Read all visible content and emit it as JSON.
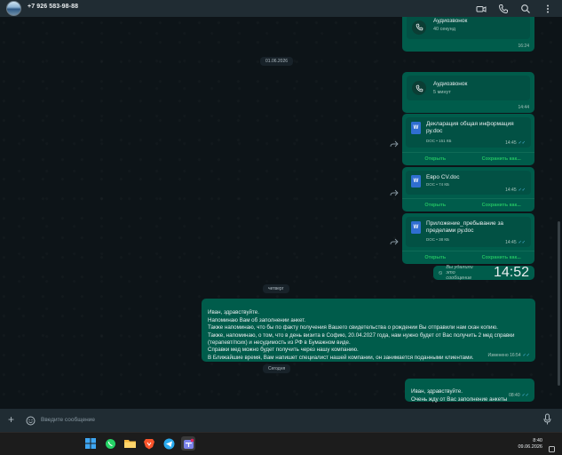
{
  "header": {
    "contact": "+7 926 583-98-88",
    "icons": [
      "video-call-icon",
      "voice-call-icon",
      "search-icon",
      "menu-dots-icon"
    ]
  },
  "messages": {
    "call1": {
      "title": "Аудиозвонок",
      "subtitle": "40 секунд",
      "time": "16:24"
    },
    "date1": "01.06.2026",
    "call2": {
      "title": "Аудиозвонок",
      "subtitle": "5 минут",
      "time": "14:44"
    },
    "doc1": {
      "name": "Декларация общая информация ру.doc",
      "meta": "DOC • 151 КБ",
      "time": "14:45",
      "open": "Открыть",
      "save": "Сохранить как..."
    },
    "doc2": {
      "name": "Евро CV.doc",
      "meta": "DOC • 74 КБ",
      "time": "14:45",
      "open": "Открыть",
      "save": "Сохранить как..."
    },
    "doc3": {
      "name": "Приложение_пребывание за пределами ру.doc",
      "meta": "DOC • 38 КБ",
      "time": "14:45",
      "open": "Открыть",
      "save": "Сохранить как..."
    },
    "deleted": {
      "text": "Вы удалили это сообщение",
      "time": "14:52"
    },
    "date2": "четверг",
    "long": {
      "text": "Иван, здравствуйте.\nНапоминаю Вам об заполнении анкет.\nТакже напоминаю, что бы по факту получения Вашего свидетельства о рождении Вы отправили нам скан копию.\nТакже, напоминаю, о том, что в день визита в Софию, 20.04.2027 года, нам нужно будет от Вас получить 2 мед справки\n(терапевт/псих) и несудимость из РФ в Бумажном виде.\nСправки мед можно будет получить через нашу компанию.\nВ Ближайшие время, Вам напишет специалист нашей компании, он занимается поданными клиентами.",
      "time": "Изменено 16:54"
    },
    "date3": "Сегодня",
    "last": {
      "text": "Иван, здравствуйте.\nОчень жду от Вас заполнение анкеты",
      "time": "08:40"
    }
  },
  "composer": {
    "placeholder": "Введите сообщение"
  },
  "taskbar": {
    "apps": [
      "windows-start-icon",
      "whatsapp-icon",
      "file-explorer-icon",
      "brave-browser-icon",
      "telegram-icon",
      "teams-icon"
    ],
    "time": "8:40",
    "date": "09.06.2026"
  },
  "colors": {
    "outgoing": "#005c4b",
    "background": "#0b141a",
    "header": "#202c33",
    "accent": "#21c063"
  }
}
